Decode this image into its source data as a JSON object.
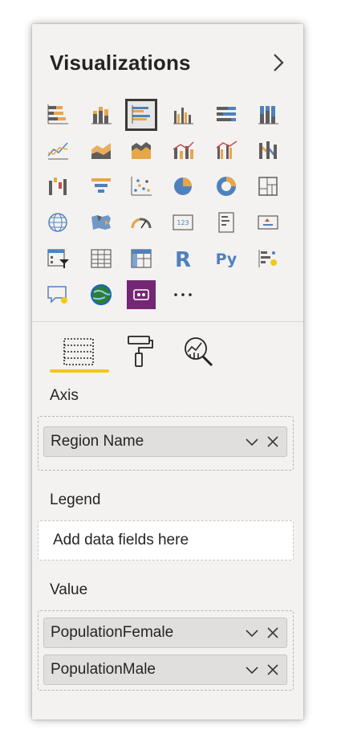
{
  "header": {
    "title": "Visualizations"
  },
  "icons": [
    "stacked-bar-chart-icon",
    "stacked-column-chart-icon",
    "clustered-bar-chart-icon",
    "clustered-column-chart-icon",
    "100-stacked-bar-chart-icon",
    "100-stacked-column-chart-icon",
    "line-chart-icon",
    "area-chart-icon",
    "stacked-area-chart-icon",
    "line-and-stacked-column-chart-icon",
    "line-and-clustered-column-chart-icon",
    "ribbon-chart-icon",
    "waterfall-chart-icon",
    "funnel-icon",
    "scatter-chart-icon",
    "pie-chart-icon",
    "donut-chart-icon",
    "treemap-icon",
    "map-icon",
    "filled-map-icon",
    "gauge-icon",
    "card-icon",
    "multi-row-card-icon",
    "kpi-icon",
    "slicer-icon",
    "table-icon",
    "matrix-icon",
    "r-script-visual-icon",
    "python-visual-icon",
    "key-influencers-icon",
    "qa-visual-icon",
    "arcgis-map-icon",
    "power-apps-icon",
    "more-visuals-icon"
  ],
  "selected_visual": "clustered-bar-chart-icon",
  "tabs": [
    "fields-tab-icon",
    "format-tab-icon",
    "analytics-tab-icon"
  ],
  "wells": {
    "axis": {
      "label": "Axis",
      "fields": [
        "Region Name"
      ]
    },
    "legend": {
      "label": "Legend",
      "placeholder": "Add data fields here"
    },
    "value": {
      "label": "Value",
      "fields": [
        "PopulationFemale",
        "PopulationMale"
      ]
    }
  },
  "colors": {
    "accent": "#f2c811",
    "bar_gray": "#605e5c",
    "bar_orange": "#e8a64b",
    "bar_blue": "#4f81bd",
    "purple": "#742774"
  }
}
